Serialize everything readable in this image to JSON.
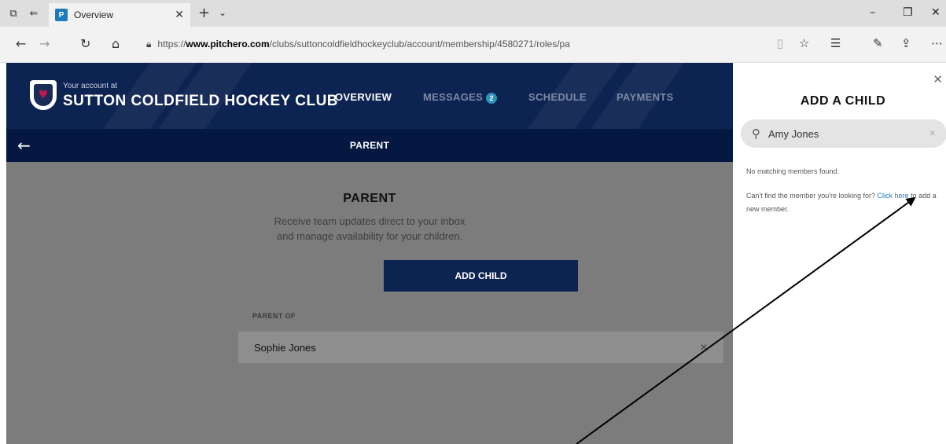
{
  "browser": {
    "tab_title": "Overview",
    "url_prefix": "https://",
    "url_host": "www.pitchero.com",
    "url_path": "/clubs/suttoncoldfieldhockeyclub/account/membership/4580271/roles/pa"
  },
  "header": {
    "account_prefix": "Your account at",
    "club_name": "SUTTON COLDFIELD HOCKEY CLUB",
    "nav": {
      "overview": "OVERVIEW",
      "messages": "MESSAGES",
      "messages_count": "2",
      "schedule": "SCHEDULE",
      "payments": "PAYMENTS"
    }
  },
  "subbar": {
    "title": "PARENT"
  },
  "main": {
    "role_title": "PARENT",
    "role_desc_line1": "Receive team updates direct to your inbox",
    "role_desc_line2": "and manage availability for your children.",
    "add_child_label": "ADD CHILD",
    "parent_of_label": "PARENT OF",
    "children": [
      {
        "name": "Sophie Jones"
      }
    ]
  },
  "panel": {
    "title": "ADD A CHILD",
    "search_value": "Amy Jones",
    "no_match": "No matching members found.",
    "help_text": "Can't find the member you're looking for?",
    "help_link": "Click here",
    "help_suffix": "to add a new member."
  },
  "colors": {
    "brand_navy": "#0d2351",
    "link_blue": "#1a7fc4",
    "badge_teal": "#2a93b5"
  }
}
